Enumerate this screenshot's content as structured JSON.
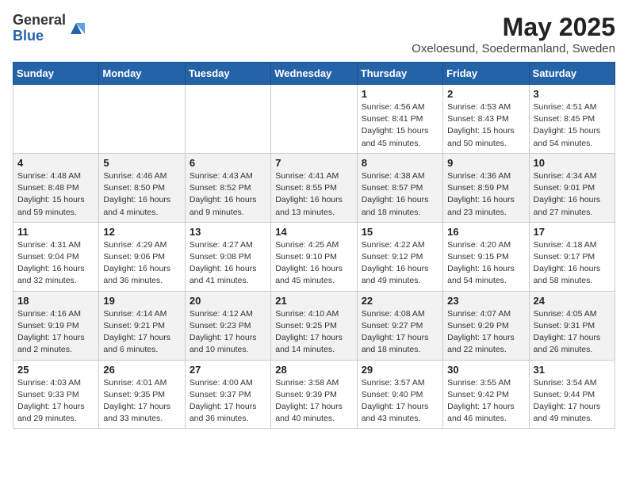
{
  "header": {
    "logo_general": "General",
    "logo_blue": "Blue",
    "month": "May 2025",
    "location": "Oxeloesund, Soedermanland, Sweden"
  },
  "days_of_week": [
    "Sunday",
    "Monday",
    "Tuesday",
    "Wednesday",
    "Thursday",
    "Friday",
    "Saturday"
  ],
  "weeks": [
    [
      {
        "day": "",
        "info": ""
      },
      {
        "day": "",
        "info": ""
      },
      {
        "day": "",
        "info": ""
      },
      {
        "day": "",
        "info": ""
      },
      {
        "day": "1",
        "info": "Sunrise: 4:56 AM\nSunset: 8:41 PM\nDaylight: 15 hours\nand 45 minutes."
      },
      {
        "day": "2",
        "info": "Sunrise: 4:53 AM\nSunset: 8:43 PM\nDaylight: 15 hours\nand 50 minutes."
      },
      {
        "day": "3",
        "info": "Sunrise: 4:51 AM\nSunset: 8:45 PM\nDaylight: 15 hours\nand 54 minutes."
      }
    ],
    [
      {
        "day": "4",
        "info": "Sunrise: 4:48 AM\nSunset: 8:48 PM\nDaylight: 15 hours\nand 59 minutes."
      },
      {
        "day": "5",
        "info": "Sunrise: 4:46 AM\nSunset: 8:50 PM\nDaylight: 16 hours\nand 4 minutes."
      },
      {
        "day": "6",
        "info": "Sunrise: 4:43 AM\nSunset: 8:52 PM\nDaylight: 16 hours\nand 9 minutes."
      },
      {
        "day": "7",
        "info": "Sunrise: 4:41 AM\nSunset: 8:55 PM\nDaylight: 16 hours\nand 13 minutes."
      },
      {
        "day": "8",
        "info": "Sunrise: 4:38 AM\nSunset: 8:57 PM\nDaylight: 16 hours\nand 18 minutes."
      },
      {
        "day": "9",
        "info": "Sunrise: 4:36 AM\nSunset: 8:59 PM\nDaylight: 16 hours\nand 23 minutes."
      },
      {
        "day": "10",
        "info": "Sunrise: 4:34 AM\nSunset: 9:01 PM\nDaylight: 16 hours\nand 27 minutes."
      }
    ],
    [
      {
        "day": "11",
        "info": "Sunrise: 4:31 AM\nSunset: 9:04 PM\nDaylight: 16 hours\nand 32 minutes."
      },
      {
        "day": "12",
        "info": "Sunrise: 4:29 AM\nSunset: 9:06 PM\nDaylight: 16 hours\nand 36 minutes."
      },
      {
        "day": "13",
        "info": "Sunrise: 4:27 AM\nSunset: 9:08 PM\nDaylight: 16 hours\nand 41 minutes."
      },
      {
        "day": "14",
        "info": "Sunrise: 4:25 AM\nSunset: 9:10 PM\nDaylight: 16 hours\nand 45 minutes."
      },
      {
        "day": "15",
        "info": "Sunrise: 4:22 AM\nSunset: 9:12 PM\nDaylight: 16 hours\nand 49 minutes."
      },
      {
        "day": "16",
        "info": "Sunrise: 4:20 AM\nSunset: 9:15 PM\nDaylight: 16 hours\nand 54 minutes."
      },
      {
        "day": "17",
        "info": "Sunrise: 4:18 AM\nSunset: 9:17 PM\nDaylight: 16 hours\nand 58 minutes."
      }
    ],
    [
      {
        "day": "18",
        "info": "Sunrise: 4:16 AM\nSunset: 9:19 PM\nDaylight: 17 hours\nand 2 minutes."
      },
      {
        "day": "19",
        "info": "Sunrise: 4:14 AM\nSunset: 9:21 PM\nDaylight: 17 hours\nand 6 minutes."
      },
      {
        "day": "20",
        "info": "Sunrise: 4:12 AM\nSunset: 9:23 PM\nDaylight: 17 hours\nand 10 minutes."
      },
      {
        "day": "21",
        "info": "Sunrise: 4:10 AM\nSunset: 9:25 PM\nDaylight: 17 hours\nand 14 minutes."
      },
      {
        "day": "22",
        "info": "Sunrise: 4:08 AM\nSunset: 9:27 PM\nDaylight: 17 hours\nand 18 minutes."
      },
      {
        "day": "23",
        "info": "Sunrise: 4:07 AM\nSunset: 9:29 PM\nDaylight: 17 hours\nand 22 minutes."
      },
      {
        "day": "24",
        "info": "Sunrise: 4:05 AM\nSunset: 9:31 PM\nDaylight: 17 hours\nand 26 minutes."
      }
    ],
    [
      {
        "day": "25",
        "info": "Sunrise: 4:03 AM\nSunset: 9:33 PM\nDaylight: 17 hours\nand 29 minutes."
      },
      {
        "day": "26",
        "info": "Sunrise: 4:01 AM\nSunset: 9:35 PM\nDaylight: 17 hours\nand 33 minutes."
      },
      {
        "day": "27",
        "info": "Sunrise: 4:00 AM\nSunset: 9:37 PM\nDaylight: 17 hours\nand 36 minutes."
      },
      {
        "day": "28",
        "info": "Sunrise: 3:58 AM\nSunset: 9:39 PM\nDaylight: 17 hours\nand 40 minutes."
      },
      {
        "day": "29",
        "info": "Sunrise: 3:57 AM\nSunset: 9:40 PM\nDaylight: 17 hours\nand 43 minutes."
      },
      {
        "day": "30",
        "info": "Sunrise: 3:55 AM\nSunset: 9:42 PM\nDaylight: 17 hours\nand 46 minutes."
      },
      {
        "day": "31",
        "info": "Sunrise: 3:54 AM\nSunset: 9:44 PM\nDaylight: 17 hours\nand 49 minutes."
      }
    ]
  ]
}
